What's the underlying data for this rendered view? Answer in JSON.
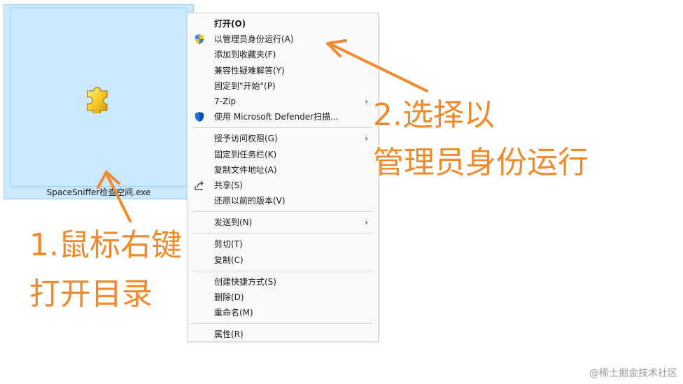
{
  "file": {
    "name": "SpaceSniffer检查空间.exe",
    "icon": "puzzle-icon"
  },
  "menu": {
    "groups": [
      [
        {
          "label": "打开(O)",
          "bold": true
        },
        {
          "label": "以管理员身份运行(A)",
          "icon": "uac-shield-icon"
        },
        {
          "label": "添加到收藏夹(F)"
        },
        {
          "label": "兼容性疑难解答(Y)"
        },
        {
          "label": "固定到\"开始\"(P)"
        },
        {
          "label": "7-Zip",
          "submenu": true
        },
        {
          "label": "使用 Microsoft Defender扫描...",
          "icon": "defender-shield-icon"
        }
      ],
      [
        {
          "label": "授予访问权限(G)",
          "submenu": true
        },
        {
          "label": "固定到任务栏(K)"
        },
        {
          "label": "复制文件地址(A)"
        },
        {
          "label": "共享(S)",
          "icon": "share-icon"
        },
        {
          "label": "还原以前的版本(V)"
        }
      ],
      [
        {
          "label": "发送到(N)",
          "submenu": true
        }
      ],
      [
        {
          "label": "剪切(T)"
        },
        {
          "label": "复制(C)"
        }
      ],
      [
        {
          "label": "创建快捷方式(S)"
        },
        {
          "label": "删除(D)"
        },
        {
          "label": "重命名(M)"
        }
      ],
      [
        {
          "label": "属性(R)"
        }
      ]
    ]
  },
  "annotations": {
    "step1_line1": "1.鼠标右键",
    "step1_line2": "打开目录",
    "step2_line1": "2.选择以",
    "step2_line2": "管理员身份运行"
  },
  "watermark": "@稀土掘金技术社区",
  "colors": {
    "annotation": "#f08a2c",
    "selection_bg": "#cce8ff",
    "selection_border": "#99d1ff",
    "menu_bg": "#f9f9f9"
  }
}
